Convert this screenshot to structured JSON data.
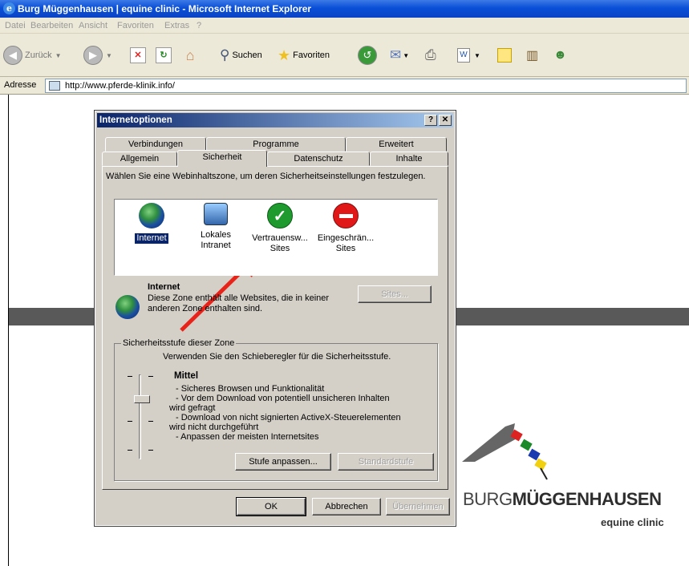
{
  "window": {
    "title": "Burg Müggenhausen | equine clinic - Microsoft Internet Explorer"
  },
  "menu": [
    "Datei",
    "Bearbeiten",
    "Ansicht",
    "Favoriten",
    "Extras",
    "?"
  ],
  "toolbar": {
    "back": "Zurück",
    "search": "Suchen",
    "favorites": "Favoriten"
  },
  "address": {
    "label": "Adresse",
    "url": "http://www.pferde-klinik.info/"
  },
  "dialog": {
    "title": "Internetoptionen",
    "help": "?",
    "close": "✕",
    "tabs_back": [
      "Verbindungen",
      "Programme",
      "Erweitert"
    ],
    "tabs_front": [
      "Allgemein",
      "Sicherheit",
      "Datenschutz",
      "Inhalte"
    ],
    "active_tab": "Sicherheit",
    "instruction": "Wählen Sie eine Webinhaltszone, um deren Sicherheitseinstellungen festzulegen.",
    "zones": [
      {
        "label1": "Internet",
        "label2": ""
      },
      {
        "label1": "Lokales",
        "label2": "Intranet"
      },
      {
        "label1": "Vertrauensw...",
        "label2": "Sites"
      },
      {
        "label1": "Eingeschrän...",
        "label2": "Sites"
      }
    ],
    "zone_name": "Internet",
    "zone_desc1": "Diese Zone enthält alle Websites, die in keiner",
    "zone_desc2": "anderen Zone enthalten sind.",
    "sites_button": "Sites...",
    "group_label": "Sicherheitsstufe dieser Zone",
    "slider_hint": "Verwenden Sie den Schieberegler für die Sicherheitsstufe.",
    "level": "Mittel",
    "level_lines": [
      "- Sicheres Browsen und Funktionalität",
      "- Vor dem Download von potentiell unsicheren Inhalten",
      "wird gefragt",
      "- Download von nicht signierten ActiveX-Steuerelementen",
      "wird nicht durchgeführt",
      "- Anpassen der meisten Internetsites"
    ],
    "custom_level": "Stufe anpassen...",
    "default_level": "Standardstufe",
    "ok": "OK",
    "cancel": "Abbrechen",
    "apply": "Übernehmen"
  },
  "logo": {
    "burg": "BURG",
    "name": "MÜGGENHAUSEN",
    "sub": "equine clinic"
  },
  "colors": {
    "accent_arrow": "#e8231a",
    "dialog_bg": "#d4d0c8",
    "title_blue": "#0a246a"
  }
}
